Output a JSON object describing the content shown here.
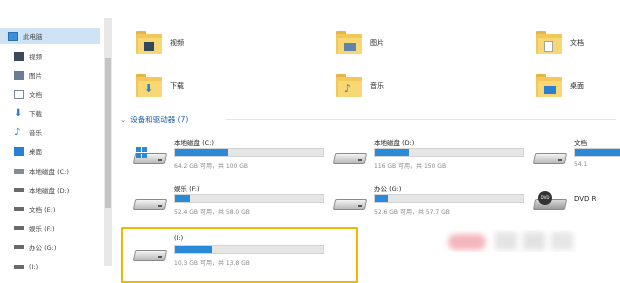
{
  "sidebar": {
    "items": [
      {
        "label": "此电脑",
        "icon": "pc-icon",
        "selected": true
      },
      {
        "label": "视频",
        "icon": "video-icon"
      },
      {
        "label": "图片",
        "icon": "pictures-icon"
      },
      {
        "label": "文档",
        "icon": "documents-icon"
      },
      {
        "label": "下载",
        "icon": "download-icon"
      },
      {
        "label": "音乐",
        "icon": "music-icon"
      },
      {
        "label": "桌面",
        "icon": "desktop-icon"
      },
      {
        "label": "本地磁盘 (C:)",
        "icon": "drive-icon"
      },
      {
        "label": "本地磁盘 (D:)",
        "icon": "drive-icon"
      },
      {
        "label": "文档 (E:)",
        "icon": "drive-icon"
      },
      {
        "label": "娱乐 (F:)",
        "icon": "drive-icon"
      },
      {
        "label": "办公 (G:)",
        "icon": "drive-icon"
      },
      {
        "label": "(I:)",
        "icon": "drive-icon"
      }
    ]
  },
  "folders": [
    {
      "label": "视频",
      "icon": "video-folder-icon"
    },
    {
      "label": "图片",
      "icon": "pictures-folder-icon"
    },
    {
      "label": "文档",
      "icon": "documents-folder-icon"
    },
    {
      "label": "下载",
      "icon": "download-folder-icon"
    },
    {
      "label": "音乐",
      "icon": "music-folder-icon"
    },
    {
      "label": "桌面",
      "icon": "desktop-folder-icon"
    }
  ],
  "devices_section": {
    "chevron": "⌄",
    "title": "设备和驱动器 (7)"
  },
  "drives": [
    {
      "name": "本地磁盘 (C:)",
      "info": "64.2 GB 可用，共 100 GB",
      "used_fraction": 0.36
    },
    {
      "name": "本地磁盘 (D:)",
      "info": "116 GB 可用，共 150 GB",
      "used_fraction": 0.23
    },
    {
      "name": "文档",
      "info": "54.1",
      "used_fraction": 0.6
    },
    {
      "name": "娱乐 (F:)",
      "info": "52.4 GB 可用，共 58.0 GB",
      "used_fraction": 0.1
    },
    {
      "name": "办公 (G:)",
      "info": "52.6 GB 可用，共 57.7 GB",
      "used_fraction": 0.09
    },
    {
      "name": "DVD R",
      "info": "",
      "used_fraction": 0
    },
    {
      "name": "(I:)",
      "info": "10.3 GB 可用，共 13.8 GB",
      "used_fraction": 0.25
    }
  ],
  "colors": {
    "accent": "#2a8ad8",
    "highlight": "#f2b705",
    "section": "#1f5fa8",
    "selected": "#cfe3f6"
  }
}
